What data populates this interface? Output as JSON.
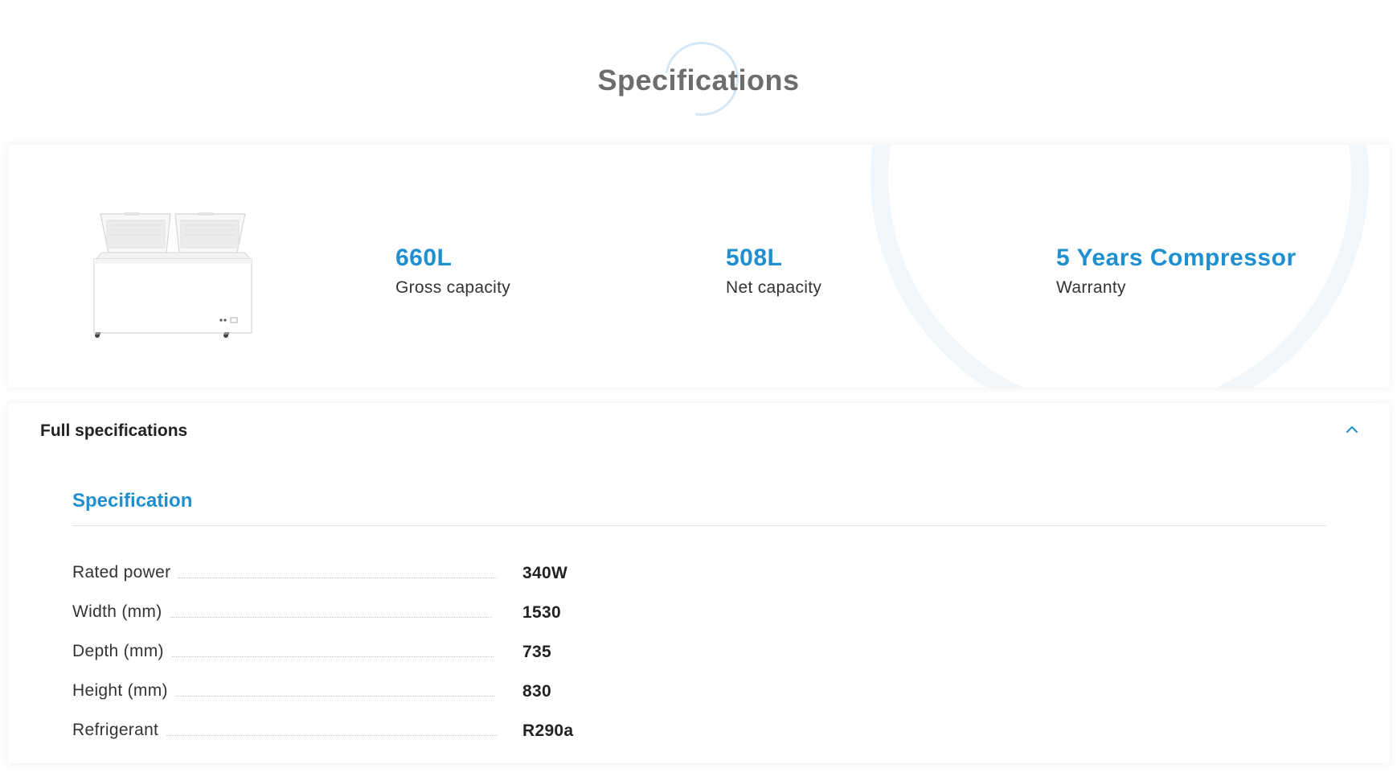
{
  "section": {
    "title": "Specifications"
  },
  "highlights": {
    "items": [
      {
        "value": "660L",
        "label": "Gross capacity"
      },
      {
        "value": "508L",
        "label": "Net capacity"
      },
      {
        "value": "5 Years Compressor",
        "label": "Warranty"
      }
    ]
  },
  "full_specs": {
    "toggle_label": "Full specifications",
    "expanded": true,
    "group_title": "Specification",
    "rows": [
      {
        "label": "Rated power",
        "value": "340W"
      },
      {
        "label": "Width (mm)",
        "value": "1530"
      },
      {
        "label": "Depth (mm)",
        "value": "735"
      },
      {
        "label": "Height (mm)",
        "value": "830"
      },
      {
        "label": "Refrigerant",
        "value": "R290a"
      }
    ]
  },
  "colors": {
    "accent": "#1f8fd0",
    "heading": "#6d6d6d",
    "text": "#333333"
  }
}
